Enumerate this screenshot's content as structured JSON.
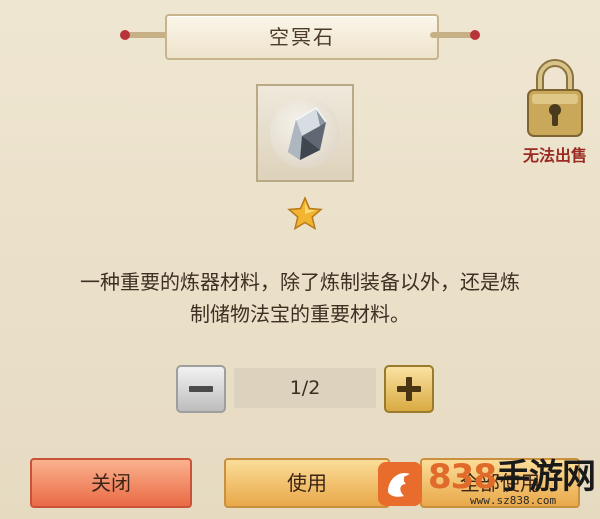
{
  "dialog": {
    "title": "空冥石",
    "item_icon": "crystal-ore-icon",
    "rarity_stars": 1,
    "sell_status": "无法出售",
    "lock_icon": "padlock-icon",
    "description_line1": "一种重要的炼器材料，除了炼制装备以外，还是炼",
    "description_line2": "制储物法宝的重要材料。"
  },
  "quantity": {
    "value": "1/2",
    "decrement_icon": "minus-icon",
    "increment_icon": "plus-icon"
  },
  "buttons": {
    "close": "关闭",
    "use": "使用",
    "use_all": "全部使用"
  },
  "watermark": {
    "brand_number": "838",
    "brand_name": "手游网",
    "url": "www.sz838.com",
    "logo_icon": "dragon-logo-icon"
  },
  "colors": {
    "panel_bg": "#e9dfc8",
    "sell_status": "#9a2a22",
    "close_button": "#ea6a46",
    "use_button": "#e9a84a",
    "watermark_orange": "#e06a2a"
  }
}
